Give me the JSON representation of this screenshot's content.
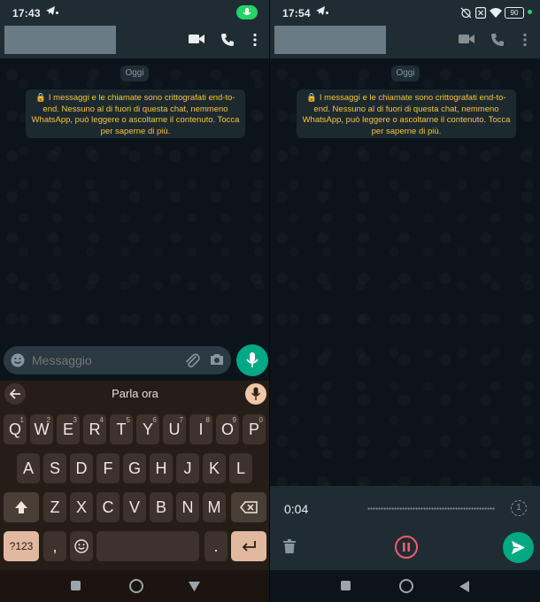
{
  "left": {
    "status": {
      "time": "17:43"
    },
    "chat": {
      "date_chip": "Oggi",
      "e2e_notice": "I messaggi e le chiamate sono crittografati end-to-end. Nessuno al di fuori di questa chat, nemmeno WhatsApp, può leggere o ascoltarne il contenuto. Tocca per saperne di più."
    },
    "composer": {
      "placeholder": "Messaggio"
    },
    "keyboard": {
      "voice_title": "Parla ora",
      "row1": [
        {
          "label": "Q",
          "hint": "1"
        },
        {
          "label": "W",
          "hint": "2"
        },
        {
          "label": "E",
          "hint": "3"
        },
        {
          "label": "R",
          "hint": "4"
        },
        {
          "label": "T",
          "hint": "5"
        },
        {
          "label": "Y",
          "hint": "6"
        },
        {
          "label": "U",
          "hint": "7"
        },
        {
          "label": "I",
          "hint": "8"
        },
        {
          "label": "O",
          "hint": "9"
        },
        {
          "label": "P",
          "hint": "0"
        }
      ],
      "row2": [
        "A",
        "S",
        "D",
        "F",
        "G",
        "H",
        "J",
        "K",
        "L"
      ],
      "row3": [
        "Z",
        "X",
        "C",
        "V",
        "B",
        "N",
        "M"
      ],
      "symbols_label": "?123",
      "comma_label": ",",
      "period_label": "."
    }
  },
  "right": {
    "status": {
      "time": "17:54",
      "battery": "90"
    },
    "chat": {
      "date_chip": "Oggi",
      "e2e_notice": "I messaggi e le chiamate sono crittografati end-to-end. Nessuno al di fuori di questa chat, nemmeno WhatsApp, può leggere o ascoltarne il contenuto. Tocca per saperne di più."
    },
    "recording": {
      "elapsed": "0:04",
      "view_once_label": "1"
    }
  },
  "colors": {
    "accent": "#00a884",
    "notice": "#f9c23c",
    "pause": "#f15c6d",
    "keyboard_bg": "#261d18"
  }
}
